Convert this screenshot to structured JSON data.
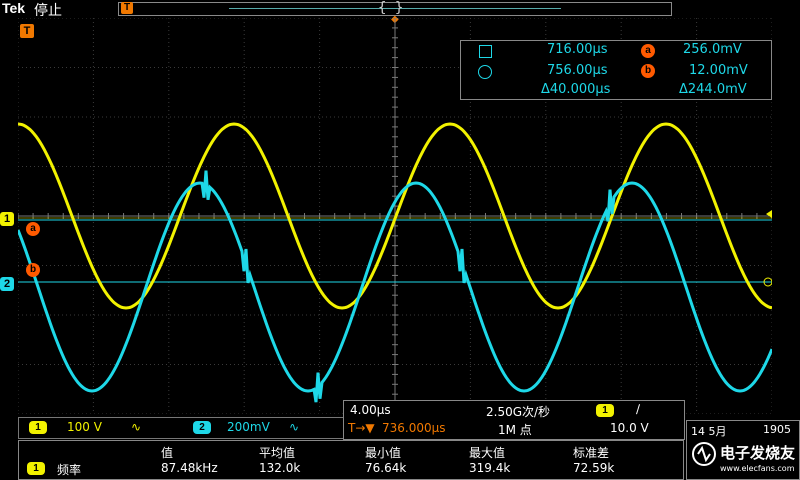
{
  "header": {
    "brand": "Tek",
    "state": "停止",
    "trigger_marker": "T"
  },
  "grid": {
    "trigger_marker": "T"
  },
  "channels": {
    "ch1": {
      "label": "1",
      "color": "#f2f200",
      "scale": "100 V",
      "coupling_icon": "∿"
    },
    "ch2": {
      "label": "2",
      "color": "#1ed8e8",
      "scale": "200mV",
      "coupling_icon": "∿"
    }
  },
  "refs": {
    "a": "a",
    "b": "b"
  },
  "cursors": {
    "t1": "716.00µs",
    "t2": "756.00µs",
    "dt": "Δ40.000µs",
    "va_label": "a",
    "vb_label": "b",
    "va": "256.0mV",
    "vb": "12.00mV",
    "dv": "Δ244.0mV"
  },
  "horizontal": {
    "timebase": "4.00µs",
    "sample_rate": "2.50G次/秒",
    "trigger_pos": "736.000µs",
    "trigger_prefix": "T→▼",
    "record": "1M 点",
    "trigger_ch": "1",
    "trigger_slope": "∕",
    "trigger_level": "10.0 V"
  },
  "measurements": {
    "ch": "1",
    "label": "频率",
    "headers": [
      "值",
      "平均值",
      "最小值",
      "最大值",
      "标准差"
    ],
    "values": [
      "87.48kHz",
      "132.0k",
      "76.64k",
      "319.4k",
      "72.59k"
    ]
  },
  "datetime": {
    "date": "14 5月",
    "time": "1905"
  },
  "watermark": {
    "text": "电子发烧友",
    "url": "www.elecfans.com"
  }
}
